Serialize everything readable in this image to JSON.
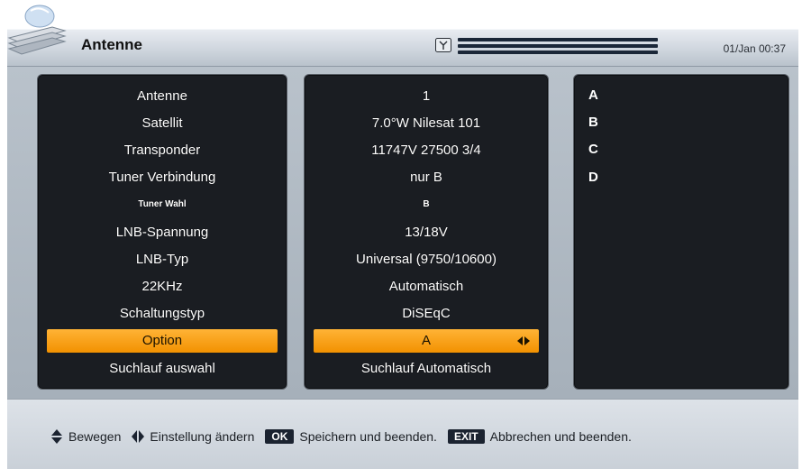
{
  "header": {
    "title": "Antenne",
    "datetime": "01/Jan 00:37",
    "signal_icon": "antenna-signal-icon"
  },
  "labels": [
    {
      "text": "Antenne",
      "small": false
    },
    {
      "text": "Satellit",
      "small": false
    },
    {
      "text": "Transponder",
      "small": false
    },
    {
      "text": "Tuner Verbindung",
      "small": false
    },
    {
      "text": "Tuner Wahl",
      "small": true
    },
    {
      "text": "LNB-Spannung",
      "small": false
    },
    {
      "text": "LNB-Typ",
      "small": false
    },
    {
      "text": "22KHz",
      "small": false
    },
    {
      "text": "Schaltungstyp",
      "small": false
    },
    {
      "text": "Option",
      "small": false
    },
    {
      "text": "Suchlauf auswahl",
      "small": false
    }
  ],
  "values": [
    {
      "text": "1",
      "small": false
    },
    {
      "text": "7.0°W Nilesat 101",
      "small": false
    },
    {
      "text": "11747V 27500 3/4",
      "small": false
    },
    {
      "text": "nur B",
      "small": false
    },
    {
      "text": "B",
      "small": true
    },
    {
      "text": "13/18V",
      "small": false
    },
    {
      "text": "Universal (9750/10600)",
      "small": false
    },
    {
      "text": "Automatisch",
      "small": false
    },
    {
      "text": "DiSEqC",
      "small": false
    },
    {
      "text": "A",
      "small": false
    },
    {
      "text": "Suchlauf Automatisch",
      "small": false
    }
  ],
  "selected_index": 9,
  "options": [
    "A",
    "B",
    "C",
    "D"
  ],
  "footer": {
    "move_icon": "up-down-arrow-icon",
    "move_label": "Bewegen",
    "change_icon": "left-right-arrow-icon",
    "change_label": "Einstellung ändern",
    "ok_key": "OK",
    "ok_label": "Speichern und beenden.",
    "exit_key": "EXIT",
    "exit_label": "Abbrechen und beenden."
  },
  "colors": {
    "highlight": "#f29100",
    "panel": "#1a1d22",
    "frame": "#b0bac4"
  }
}
